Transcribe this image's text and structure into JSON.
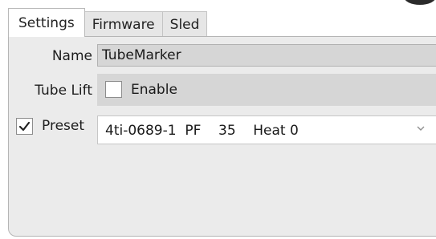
{
  "tabs": [
    {
      "label": "Settings",
      "active": true
    },
    {
      "label": "Firmware",
      "active": false
    },
    {
      "label": "Sled",
      "active": false
    }
  ],
  "fields": {
    "name_label": "Name",
    "name_value": "TubeMarker",
    "tube_lift_label": "Tube Lift",
    "enable_label": "Enable",
    "enable_checked": false,
    "preset_label": "Preset",
    "preset_checked": true,
    "preset_value": "4ti-0689-1  PF    35    Heat 0"
  },
  "icons": {
    "check": "check-icon",
    "dropdown": "chevron-down-icon"
  },
  "colors": {
    "panel_bg": "#ebebeb",
    "field_bg": "#d6d6d6",
    "active_tab_bg": "#ffffff",
    "inactive_tab_bg": "#e6e6e6"
  }
}
